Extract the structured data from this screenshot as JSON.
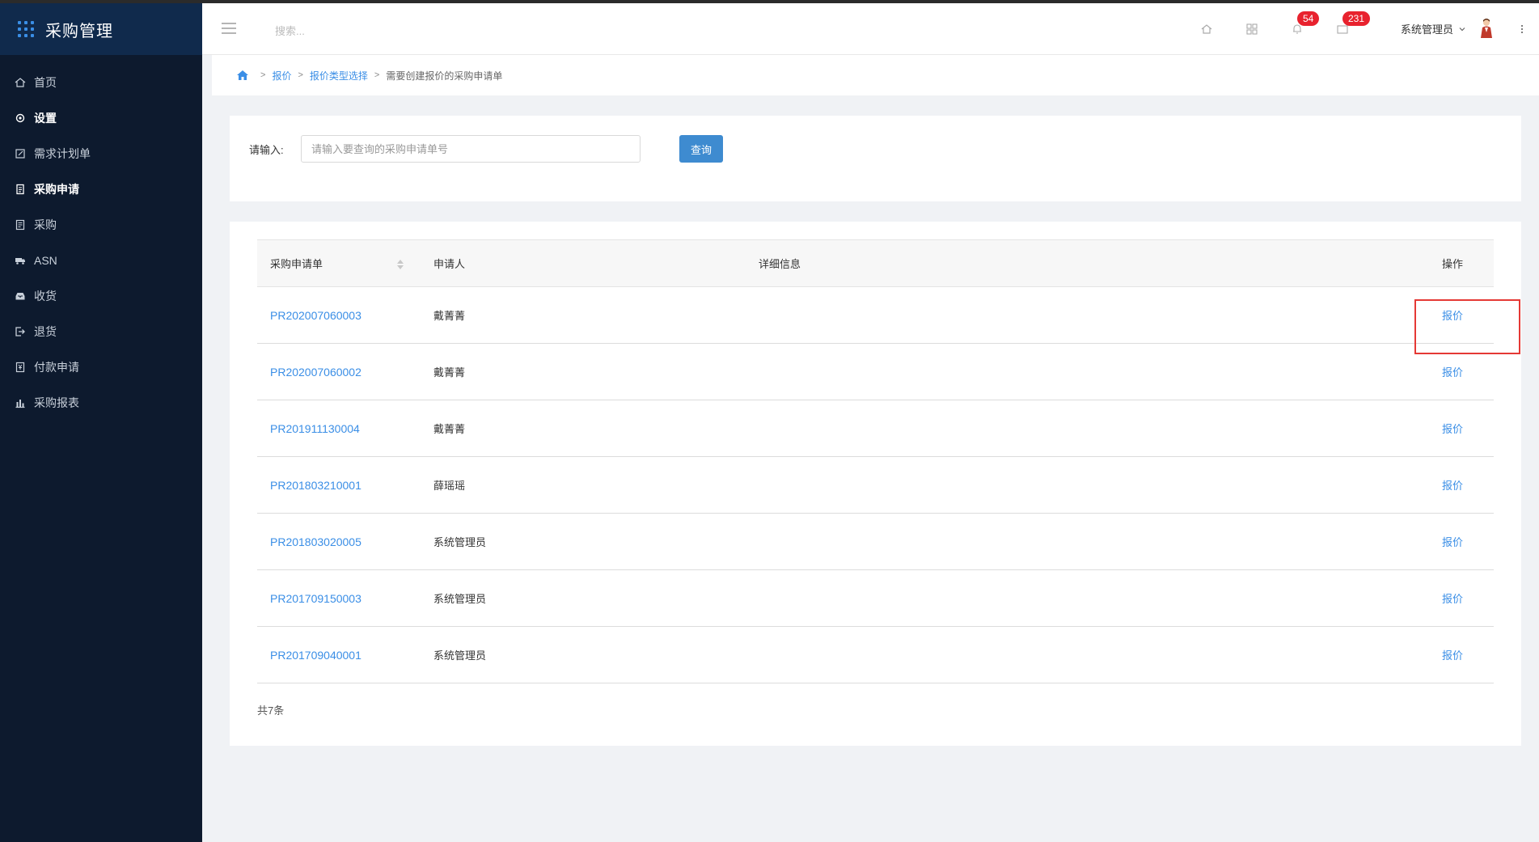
{
  "sidebar": {
    "app_title": "采购管理",
    "items": [
      {
        "label": "首页",
        "icon": "home-icon"
      },
      {
        "label": "设置",
        "icon": "gear-icon"
      },
      {
        "label": "需求计划单",
        "icon": "edit-doc-icon"
      },
      {
        "label": "采购申请",
        "icon": "document-icon"
      },
      {
        "label": "采购",
        "icon": "list-doc-icon"
      },
      {
        "label": "ASN",
        "icon": "truck-icon"
      },
      {
        "label": "收货",
        "icon": "inbox-icon"
      },
      {
        "label": "退货",
        "icon": "exit-icon"
      },
      {
        "label": "付款申请",
        "icon": "payment-doc-icon"
      },
      {
        "label": "采购报表",
        "icon": "bar-chart-icon"
      }
    ]
  },
  "header": {
    "search_placeholder": "搜索...",
    "notifications_count": "54",
    "messages_count": "231",
    "user_name": "系统管理员"
  },
  "breadcrumb": {
    "items": [
      "报价",
      "报价类型选择"
    ],
    "current": "需要创建报价的采购申请单"
  },
  "search_panel": {
    "label": "请输入:",
    "placeholder": "请输入要查询的采购申请单号",
    "button": "查询"
  },
  "table": {
    "columns": [
      "采购申请单",
      "申请人",
      "详细信息",
      "操作"
    ],
    "rows": [
      {
        "id": "PR202007060003",
        "applicant": "戴菁菁",
        "detail": "",
        "action": "报价"
      },
      {
        "id": "PR202007060002",
        "applicant": "戴菁菁",
        "detail": "",
        "action": "报价"
      },
      {
        "id": "PR201911130004",
        "applicant": "戴菁菁",
        "detail": "",
        "action": "报价"
      },
      {
        "id": "PR201803210001",
        "applicant": "薛瑶瑶",
        "detail": "",
        "action": "报价"
      },
      {
        "id": "PR201803020005",
        "applicant": "系统管理员",
        "detail": "",
        "action": "报价"
      },
      {
        "id": "PR201709150003",
        "applicant": "系统管理员",
        "detail": "",
        "action": "报价"
      },
      {
        "id": "PR201709040001",
        "applicant": "系统管理员",
        "detail": "",
        "action": "报价"
      }
    ],
    "total": "共7条"
  },
  "colors": {
    "sidebar_bg": "#0d1a2e",
    "brand_bg": "#102a4c",
    "link": "#3a8ee6",
    "primary_button": "#3e8bd0",
    "badge": "#e8222e",
    "highlight": "#e53935"
  }
}
